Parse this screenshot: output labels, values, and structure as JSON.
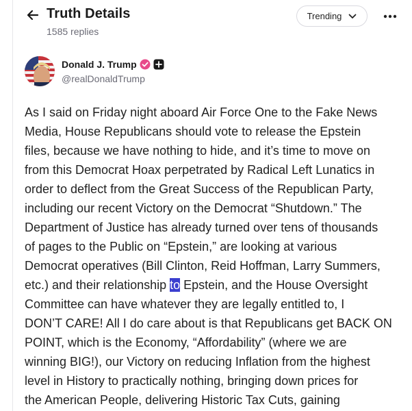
{
  "header": {
    "title": "Truth Details",
    "replies": "1585 replies",
    "sort_label": "Trending"
  },
  "author": {
    "name": "Donald J. Trump",
    "handle": "@realDonaldTrump"
  },
  "post": {
    "lines": [
      "As I said on Friday night aboard Air Force One to the Fake News",
      "Media, House Republicans should vote to release the Epstein",
      "files, because we have nothing to hide, and it’s time to move on",
      "from this Democrat Hoax perpetrated by Radical Left Lunatics in",
      "order to deflect from the Great Success of the Republican Party,",
      "including our recent Victory on the Democrat “Shutdown.” The",
      "Department of Justice has already turned over tens of thousands",
      "of pages to the Public on “Epstein,” are looking at various",
      "Democrat operatives (Bill Clinton, Reid Hoffman, Larry Summers,"
    ],
    "line10_before": "etc.) and their relationship ",
    "line10_selected": "to",
    "line10_after": " Epstein, and the House Oversight",
    "lines_after": [
      "Committee can have whatever they are legally entitled to, I",
      "DON’T CARE! All I do care about is that Republicans get BACK ON",
      "POINT, which is the Economy, “Affordability” (where we are",
      "winning BIG!), our Victory on reducing Inflation from the highest",
      "level in History to practically nothing, bringing down prices for",
      "the American People, delivering Historic Tax Cuts, gaining"
    ]
  },
  "colors": {
    "accent": "#3b3fcf",
    "verified_badge": "#e84a8a",
    "muted_text": "#6b6b76"
  },
  "icons": {
    "back": "arrow-left-icon",
    "sort": "chevron-down-icon",
    "more": "more-horizontal-icon",
    "verified": "verified-badge-icon",
    "follow": "plus-square-icon"
  }
}
